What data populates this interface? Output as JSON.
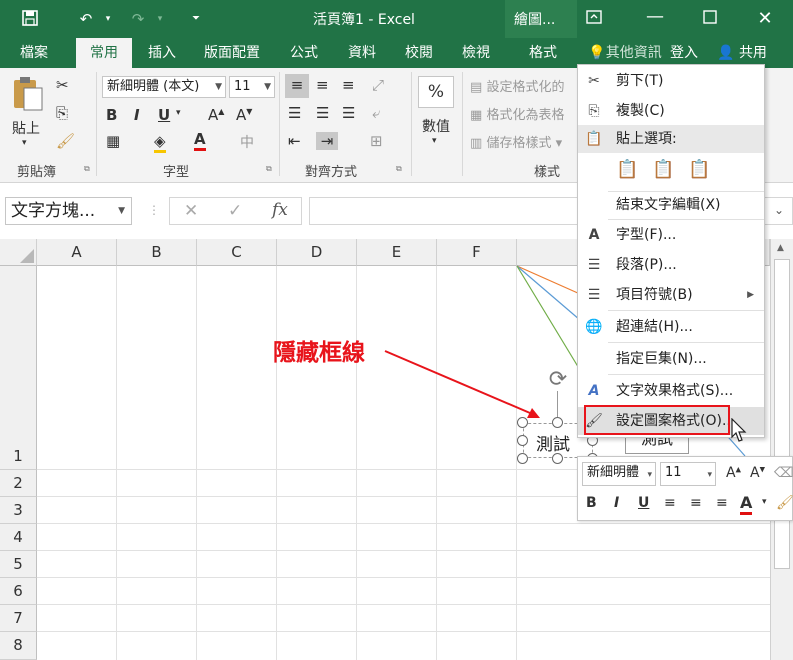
{
  "title_bar": {
    "title": "活頁簿1 - Excel",
    "drawing_tools": "繪圖..."
  },
  "tabs": [
    "檔案",
    "常用",
    "插入",
    "版面配置",
    "公式",
    "資料",
    "校閱",
    "檢視",
    "格式"
  ],
  "tell_me": "其他資訊",
  "login": "登入",
  "share": "共用",
  "ribbon": {
    "paste": "貼上",
    "clipboard": "剪貼簿",
    "font_name": "新細明體 (本文)",
    "font_size": "11",
    "font_group": "字型",
    "align_group": "對齊方式",
    "number": "數值",
    "cond_format": "設定格式化的",
    "format_table": "格式化為表格",
    "cell_styles": "儲存格樣式",
    "styles_group": "樣式"
  },
  "formula_bar": {
    "name_box": "文字方塊..."
  },
  "columns": [
    "A",
    "B",
    "C",
    "D",
    "E",
    "F"
  ],
  "rows": [
    "1",
    "2",
    "3",
    "4",
    "5",
    "6",
    "7",
    "8"
  ],
  "annotation": {
    "text": "隱藏框線",
    "color": "#e8141b"
  },
  "shape_text": "測試",
  "context_menu": {
    "cut": "剪下(T)",
    "copy": "複製(C)",
    "paste_options": "貼上選項:",
    "exit_edit": "結束文字編輯(X)",
    "font": "字型(F)...",
    "paragraph": "段落(P)...",
    "bullets": "項目符號(B)",
    "hyperlink": "超連結(H)...",
    "macro": "指定巨集(N)...",
    "text_effects": "文字效果格式(S)...",
    "format_shape": "設定圖案格式(O)..."
  },
  "mini_toolbar": {
    "font": "新細明體",
    "size": "11"
  },
  "colors": {
    "excel_green": "#217346",
    "highlight_red": "#e8141b"
  }
}
